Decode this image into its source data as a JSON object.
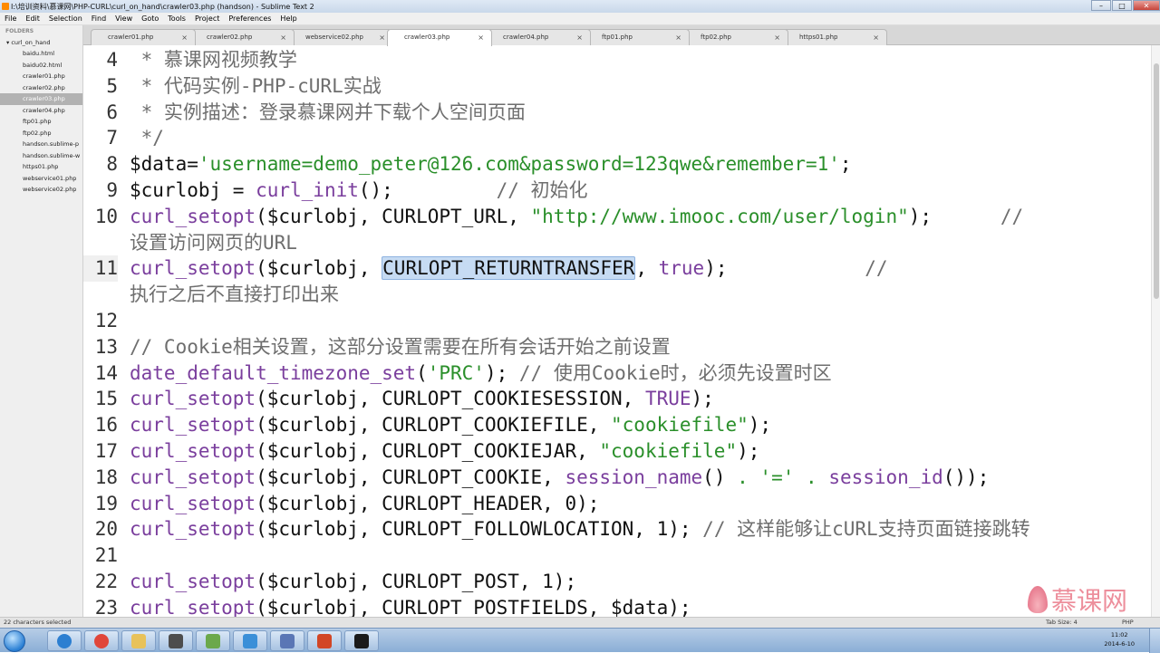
{
  "window": {
    "title": "I:\\培训资料\\慕课网\\PHP-CURL\\curl_on_hand\\crawler03.php (handson) - Sublime Text 2",
    "controls": [
      "–",
      "□",
      "✕"
    ]
  },
  "menu": [
    "File",
    "Edit",
    "Selection",
    "Find",
    "View",
    "Goto",
    "Tools",
    "Project",
    "Preferences",
    "Help"
  ],
  "sidebar": {
    "header": "FOLDERS",
    "folder": "curl_on_hand",
    "files": [
      "baidu.html",
      "baidu02.html",
      "crawler01.php",
      "crawler02.php",
      "crawler03.php",
      "crawler04.php",
      "ftp01.php",
      "ftp02.php",
      "handson.sublime-p",
      "handson.sublime-w",
      "https01.php",
      "webservice01.php",
      "webservice02.php"
    ],
    "active_index": 4
  },
  "tabs": [
    {
      "label": "crawler01.php",
      "active": false
    },
    {
      "label": "crawler02.php",
      "active": false
    },
    {
      "label": "webservice02.php",
      "active": false
    },
    {
      "label": "crawler03.php",
      "active": true
    },
    {
      "label": "crawler04.php",
      "active": false
    },
    {
      "label": "ftp01.php",
      "active": false
    },
    {
      "label": "ftp02.php",
      "active": false
    },
    {
      "label": "https01.php",
      "active": false
    }
  ],
  "tab_close": "×",
  "code": [
    {
      "n": "4",
      "segs": [
        [
          " * 慕课网视频教学",
          "comment"
        ]
      ]
    },
    {
      "n": "5",
      "segs": [
        [
          " * 代码实例-PHP-cURL实战",
          "comment"
        ]
      ]
    },
    {
      "n": "6",
      "segs": [
        [
          " * 实例描述：登录慕课网并下载个人空间页面",
          "comment"
        ]
      ]
    },
    {
      "n": "7",
      "segs": [
        [
          " */",
          "comment"
        ]
      ]
    },
    {
      "n": "8",
      "segs": [
        [
          "$data",
          "var"
        ],
        [
          "=",
          "plain"
        ],
        [
          "'username=demo_peter@126.com&password=123qwe&remember=1'",
          "str"
        ],
        [
          ";",
          "plain"
        ]
      ]
    },
    {
      "n": "9",
      "segs": [
        [
          "$curlobj",
          "var"
        ],
        [
          " = ",
          "plain"
        ],
        [
          "curl_init",
          "func"
        ],
        [
          "();         ",
          "plain"
        ],
        [
          "// 初始化",
          "comment"
        ]
      ]
    },
    {
      "n": "10",
      "segs": [
        [
          "curl_setopt",
          "func"
        ],
        [
          "($curlobj, CURLOPT_URL, ",
          "plain"
        ],
        [
          "\"http://www.imooc.com/user/login\"",
          "str"
        ],
        [
          ");      ",
          "plain"
        ],
        [
          "//",
          "comment"
        ]
      ]
    },
    {
      "n": "",
      "segs": [
        [
          "设置访问网页的URL",
          "comment"
        ]
      ]
    },
    {
      "n": "11",
      "active": true,
      "segs": [
        [
          "curl_setopt",
          "func"
        ],
        [
          "($curlobj, ",
          "plain"
        ],
        [
          "CURLOPT_RETURNTRANSFER",
          "sel"
        ],
        [
          ", ",
          "plain"
        ],
        [
          "true",
          "kw"
        ],
        [
          ");            ",
          "plain"
        ],
        [
          "//",
          "comment"
        ]
      ]
    },
    {
      "n": "",
      "segs": [
        [
          "执行之后不直接打印出来",
          "comment"
        ]
      ]
    },
    {
      "n": "12",
      "segs": []
    },
    {
      "n": "13",
      "segs": [
        [
          "// Cookie相关设置，这部分设置需要在所有会话开始之前设置",
          "comment"
        ]
      ]
    },
    {
      "n": "14",
      "segs": [
        [
          "date_default_timezone_set",
          "func"
        ],
        [
          "(",
          "plain"
        ],
        [
          "'PRC'",
          "str"
        ],
        [
          "); ",
          "plain"
        ],
        [
          "// 使用Cookie时，必须先设置时区",
          "comment"
        ]
      ]
    },
    {
      "n": "15",
      "segs": [
        [
          "curl_setopt",
          "func"
        ],
        [
          "($curlobj, CURLOPT_COOKIESESSION, ",
          "plain"
        ],
        [
          "TRUE",
          "kw"
        ],
        [
          ");",
          "plain"
        ]
      ]
    },
    {
      "n": "16",
      "segs": [
        [
          "curl_setopt",
          "func"
        ],
        [
          "($curlobj, CURLOPT_COOKIEFILE, ",
          "plain"
        ],
        [
          "\"cookiefile\"",
          "str"
        ],
        [
          ");",
          "plain"
        ]
      ]
    },
    {
      "n": "17",
      "segs": [
        [
          "curl_setopt",
          "func"
        ],
        [
          "($curlobj, CURLOPT_COOKIEJAR, ",
          "plain"
        ],
        [
          "\"cookiefile\"",
          "str"
        ],
        [
          ");",
          "plain"
        ]
      ]
    },
    {
      "n": "18",
      "segs": [
        [
          "curl_setopt",
          "func"
        ],
        [
          "($curlobj, CURLOPT_COOKIE, ",
          "plain"
        ],
        [
          "session_name",
          "func"
        ],
        [
          "() ",
          "plain"
        ],
        [
          ".",
          "str"
        ],
        [
          " ",
          "plain"
        ],
        [
          "'='",
          "str"
        ],
        [
          " ",
          "plain"
        ],
        [
          ".",
          "str"
        ],
        [
          " ",
          "plain"
        ],
        [
          "session_id",
          "func"
        ],
        [
          "());",
          "plain"
        ]
      ]
    },
    {
      "n": "19",
      "segs": [
        [
          "curl_setopt",
          "func"
        ],
        [
          "($curlobj, CURLOPT_HEADER, 0);",
          "plain"
        ]
      ]
    },
    {
      "n": "20",
      "segs": [
        [
          "curl_setopt",
          "func"
        ],
        [
          "($curlobj, CURLOPT_FOLLOWLOCATION, 1); ",
          "plain"
        ],
        [
          "// 这样能够让cURL支持页面链接跳转",
          "comment"
        ]
      ]
    },
    {
      "n": "21",
      "segs": []
    },
    {
      "n": "22",
      "segs": [
        [
          "curl_setopt",
          "func"
        ],
        [
          "($curlobj, CURLOPT_POST, 1);",
          "plain"
        ]
      ]
    },
    {
      "n": "23",
      "segs": [
        [
          "curl_setopt",
          "func"
        ],
        [
          "($curlobj, CURLOPT_POSTFIELDS, $data);",
          "plain"
        ]
      ]
    }
  ],
  "status": {
    "left": "22 characters selected",
    "tab_size": "Tab Size: 4",
    "syntax": "PHP"
  },
  "watermark": "慕课网",
  "clock": {
    "time": "11:02",
    "date": "2014-6-10"
  },
  "taskbar_apps": [
    {
      "name": "ie-icon",
      "color": "#2c7fd1"
    },
    {
      "name": "chrome-icon",
      "color": "#e0463a"
    },
    {
      "name": "folder-icon",
      "color": "#e8c25a"
    },
    {
      "name": "sublime-icon",
      "color": "#4d4d4d"
    },
    {
      "name": "notepad-icon",
      "color": "#6ba84b"
    },
    {
      "name": "vmware-icon",
      "color": "#3a8fd8"
    },
    {
      "name": "network-icon",
      "color": "#5a76b5"
    },
    {
      "name": "powerpoint-icon",
      "color": "#d24625"
    },
    {
      "name": "terminal-icon",
      "color": "#1a1a1a"
    }
  ]
}
